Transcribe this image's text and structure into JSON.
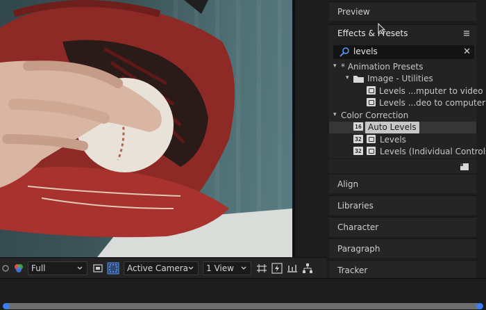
{
  "panels": {
    "preview": "Preview",
    "effects_title": "Effects & Presets",
    "align": "Align",
    "libraries": "Libraries",
    "character": "Character",
    "paragraph": "Paragraph",
    "tracker": "Tracker"
  },
  "search": {
    "value": "levels",
    "clear": "✕"
  },
  "tree": {
    "animation_presets": "* Animation Presets",
    "image_utilities": "Image - Utilities",
    "preset_1": "Levels ...mputer to video",
    "preset_2": "Levels ...deo to computer",
    "color_correction": "Color Correction",
    "auto_levels": "Auto Levels",
    "auto_levels_bits": "16",
    "levels": "Levels",
    "levels_bits": "32",
    "levels_individual": "Levels (Individual Controls)",
    "levels_individual_bits": "32"
  },
  "toolbar": {
    "resolution": "Full",
    "camera": "Active Camera",
    "view": "1 View"
  },
  "colors": {
    "accent": "#3b7ef5",
    "panel_bg": "#232323",
    "search_bg": "#141414"
  }
}
